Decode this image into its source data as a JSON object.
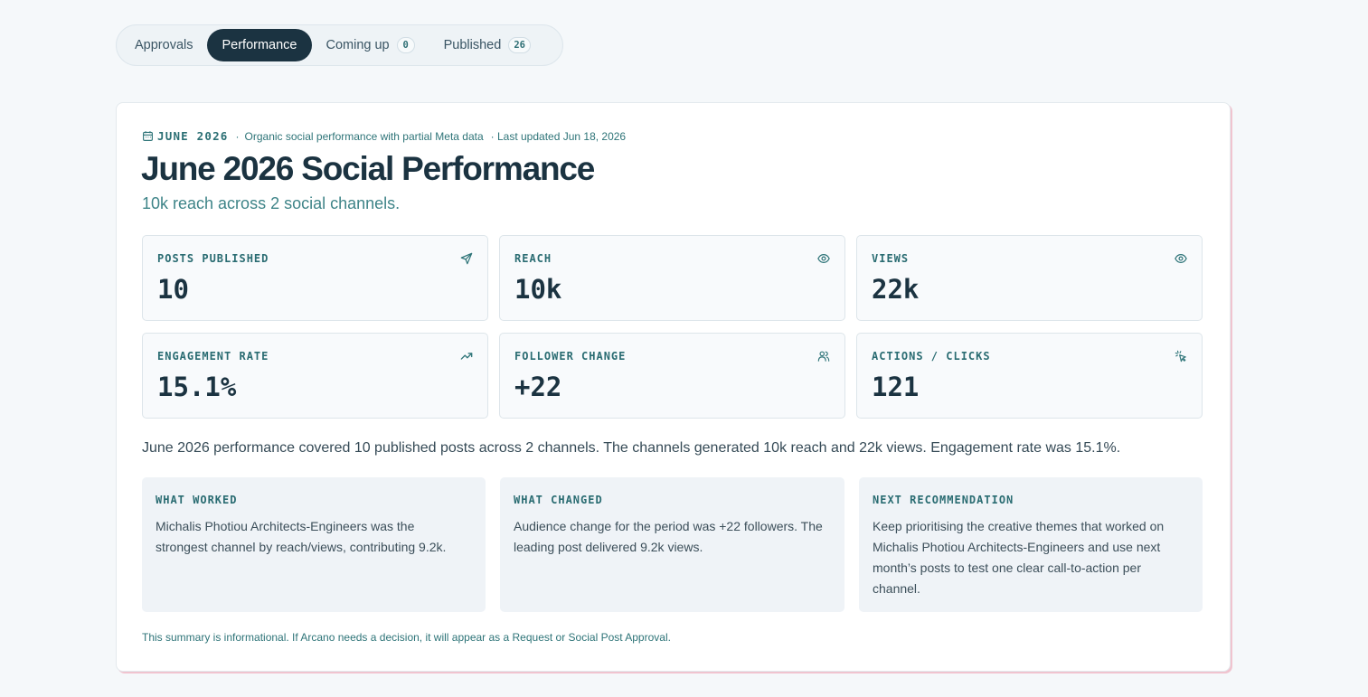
{
  "tabs": [
    {
      "label": "Approvals",
      "count": null,
      "active": false
    },
    {
      "label": "Performance",
      "count": null,
      "active": true
    },
    {
      "label": "Coming up",
      "count": "0",
      "active": false
    },
    {
      "label": "Published",
      "count": "26",
      "active": false
    }
  ],
  "report": {
    "month": "JUNE 2026",
    "separator": "·",
    "description": "Organic social performance with partial Meta data",
    "updated": "· Last updated Jun 18, 2026",
    "title": "June 2026 Social Performance",
    "subtitle": "10k reach across 2 social channels.",
    "stats": [
      {
        "label": "POSTS PUBLISHED",
        "value": "10",
        "icon": "send-icon"
      },
      {
        "label": "REACH",
        "value": "10k",
        "icon": "eye-icon"
      },
      {
        "label": "VIEWS",
        "value": "22k",
        "icon": "eye-icon"
      },
      {
        "label": "ENGAGEMENT RATE",
        "value": "15.1%",
        "icon": "trending-up-icon"
      },
      {
        "label": "FOLLOWER CHANGE",
        "value": "+22",
        "icon": "users-icon"
      },
      {
        "label": "ACTIONS / CLICKS",
        "value": "121",
        "icon": "pointer-click-icon"
      }
    ],
    "summary": "June 2026 performance covered 10 published posts across 2 channels. The channels generated 10k reach and 22k views. Engagement rate was 15.1%.",
    "insights": [
      {
        "title": "WHAT WORKED",
        "text": "Michalis Photiou Architects-Engineers was the strongest channel by reach/views, contributing 9.2k."
      },
      {
        "title": "WHAT CHANGED",
        "text": "Audience change for the period was +22 followers. The leading post delivered 9.2k views."
      },
      {
        "title": "NEXT RECOMMENDATION",
        "text": "Keep prioritising the creative themes that worked on Michalis Photiou Architects-Engineers and use next month’s posts to test one clear call-to-action per channel."
      }
    ],
    "footnote": "This summary is informational. If Arcano needs a decision, it will appear as a Request or Social Post Approval."
  },
  "colors": {
    "accent": "#1b3341",
    "teal": "#2e7478",
    "card_shadow": "#f0c4cf"
  }
}
